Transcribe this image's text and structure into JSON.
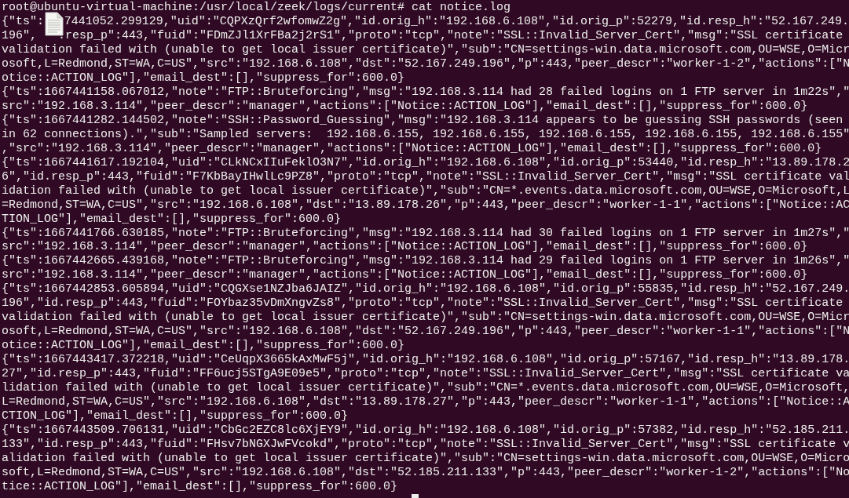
{
  "terminal": {
    "lines": [
      {
        "text": "root@ubuntu-virtual-machine:/usr/local/zeek/logs/current# cat notice.log"
      },
      {
        "parts": [
          "{\"ts\":",
          "7441052.299129,\"uid\":\"CQPXzQrf2wfomwZ2g\",\"id.orig_h\":\"192.168.6.108\",\"id.orig_p\":52279,\"id.resp_h\":\"52.167.249."
        ]
      },
      {
        "parts": [
          "196\",",
          ".resp_p\":443,\"fuid\":\"FDmZJl1XrFBa2j2rS1\",\"proto\":\"tcp\",\"note\":\"SSL::Invalid_Server_Cert\",\"msg\":\"SSL certificate"
        ]
      },
      {
        "text": "validation failed with (unable to get local issuer certificate)\",\"sub\":\"CN=settings-win.data.microsoft.com,OU=WSE,O=Micr"
      },
      {
        "text": "osoft,L=Redmond,ST=WA,C=US\",\"src\":\"192.168.6.108\",\"dst\":\"52.167.249.196\",\"p\":443,\"peer_descr\":\"worker-1-2\",\"actions\":[\"N"
      },
      {
        "text": "otice::ACTION_LOG\"],\"email_dest\":[],\"suppress_for\":600.0}"
      },
      {
        "text": "{\"ts\":1667441158.067012,\"note\":\"FTP::Bruteforcing\",\"msg\":\"192.168.3.114 had 28 failed logins on 1 FTP server in 1m22s\",\""
      },
      {
        "text": "src\":\"192.168.3.114\",\"peer_descr\":\"manager\",\"actions\":[\"Notice::ACTION_LOG\"],\"email_dest\":[],\"suppress_for\":600.0}"
      },
      {
        "text": "{\"ts\":1667441282.144502,\"note\":\"SSH::Password_Guessing\",\"msg\":\"192.168.3.114 appears to be guessing SSH passwords (seen"
      },
      {
        "text": "in 62 connections).\",\"sub\":\"Sampled servers:  192.168.6.155, 192.168.6.155, 192.168.6.155, 192.168.6.155, 192.168.6.155\""
      },
      {
        "text": ",\"src\":\"192.168.3.114\",\"peer_descr\":\"manager\",\"actions\":[\"Notice::ACTION_LOG\"],\"email_dest\":[],\"suppress_for\":600.0}"
      },
      {
        "text": "{\"ts\":1667441617.192104,\"uid\":\"CLkNCxIIuFeklO3N7\",\"id.orig_h\":\"192.168.6.108\",\"id.orig_p\":53440,\"id.resp_h\":\"13.89.178.2"
      },
      {
        "text": "6\",\"id.resp_p\":443,\"fuid\":\"F7KbBayIHwlLc9PZ8\",\"proto\":\"tcp\",\"note\":\"SSL::Invalid_Server_Cert\",\"msg\":\"SSL certificate val"
      },
      {
        "text": "idation failed with (unable to get local issuer certificate)\",\"sub\":\"CN=*.events.data.microsoft.com,OU=WSE,O=Microsoft,L"
      },
      {
        "text": "=Redmond,ST=WA,C=US\",\"src\":\"192.168.6.108\",\"dst\":\"13.89.178.26\",\"p\":443,\"peer_descr\":\"worker-1-1\",\"actions\":[\"Notice::AC"
      },
      {
        "text": "TION_LOG\"],\"email_dest\":[],\"suppress_for\":600.0}"
      },
      {
        "text": "{\"ts\":1667441766.630185,\"note\":\"FTP::Bruteforcing\",\"msg\":\"192.168.3.114 had 30 failed logins on 1 FTP server in 1m27s\",\""
      },
      {
        "text": "src\":\"192.168.3.114\",\"peer_descr\":\"manager\",\"actions\":[\"Notice::ACTION_LOG\"],\"email_dest\":[],\"suppress_for\":600.0}"
      },
      {
        "text": "{\"ts\":1667442665.439168,\"note\":\"FTP::Bruteforcing\",\"msg\":\"192.168.3.114 had 29 failed logins on 1 FTP server in 1m26s\",\""
      },
      {
        "text": "src\":\"192.168.3.114\",\"peer_descr\":\"manager\",\"actions\":[\"Notice::ACTION_LOG\"],\"email_dest\":[],\"suppress_for\":600.0}"
      },
      {
        "text": "{\"ts\":1667442853.605894,\"uid\":\"CQGXse1NZJba6JAIZ\",\"id.orig_h\":\"192.168.6.108\",\"id.orig_p\":55835,\"id.resp_h\":\"52.167.249."
      },
      {
        "text": "196\",\"id.resp_p\":443,\"fuid\":\"FOYbaz35vDmXngvZs8\",\"proto\":\"tcp\",\"note\":\"SSL::Invalid_Server_Cert\",\"msg\":\"SSL certificate"
      },
      {
        "text": "validation failed with (unable to get local issuer certificate)\",\"sub\":\"CN=settings-win.data.microsoft.com,OU=WSE,O=Micr"
      },
      {
        "text": "osoft,L=Redmond,ST=WA,C=US\",\"src\":\"192.168.6.108\",\"dst\":\"52.167.249.196\",\"p\":443,\"peer_descr\":\"worker-1-1\",\"actions\":[\"N"
      },
      {
        "text": "otice::ACTION_LOG\"],\"email_dest\":[],\"suppress_for\":600.0}"
      },
      {
        "text": "{\"ts\":1667443417.372218,\"uid\":\"CeUqpX3665kAxMwF5j\",\"id.orig_h\":\"192.168.6.108\",\"id.orig_p\":57167,\"id.resp_h\":\"13.89.178."
      },
      {
        "text": "27\",\"id.resp_p\":443,\"fuid\":\"FF6ucj5STgA9E09e5\",\"proto\":\"tcp\",\"note\":\"SSL::Invalid_Server_Cert\",\"msg\":\"SSL certificate va"
      },
      {
        "text": "lidation failed with (unable to get local issuer certificate)\",\"sub\":\"CN=*.events.data.microsoft.com,OU=WSE,O=Microsoft,"
      },
      {
        "text": "L=Redmond,ST=WA,C=US\",\"src\":\"192.168.6.108\",\"dst\":\"13.89.178.27\",\"p\":443,\"peer_descr\":\"worker-1-1\",\"actions\":[\"Notice::A"
      },
      {
        "text": "CTION_LOG\"],\"email_dest\":[],\"suppress_for\":600.0}"
      },
      {
        "text": "{\"ts\":1667443509.706131,\"uid\":\"CbGc2EZC8lc6XjEY9\",\"id.orig_h\":\"192.168.6.108\",\"id.orig_p\":57382,\"id.resp_h\":\"52.185.211."
      },
      {
        "text": "133\",\"id.resp_p\":443,\"fuid\":\"FHsv7bNGXJwFVcokd\",\"proto\":\"tcp\",\"note\":\"SSL::Invalid_Server_Cert\",\"msg\":\"SSL certificate v"
      },
      {
        "text": "alidation failed with (unable to get local issuer certificate)\",\"sub\":\"CN=settings-win.data.microsoft.com,OU=WSE,O=Micro"
      },
      {
        "text": "soft,L=Redmond,ST=WA,C=US\",\"src\":\"192.168.6.108\",\"dst\":\"52.185.211.133\",\"p\":443,\"peer_descr\":\"worker-1-2\",\"actions\":[\"No"
      },
      {
        "text": "tice::ACTION_LOG\"],\"email_dest\":[],\"suppress_for\":600.0}"
      }
    ]
  }
}
